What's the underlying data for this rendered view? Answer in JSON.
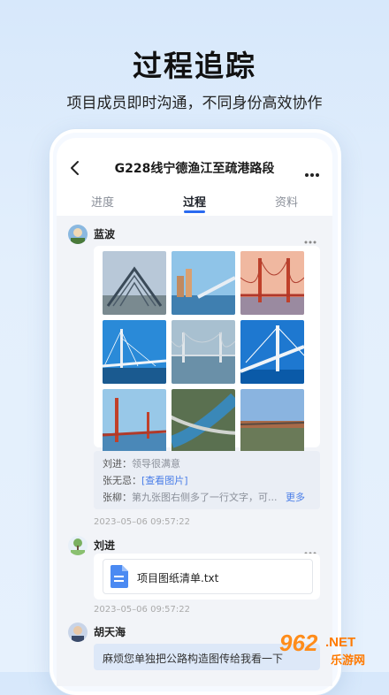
{
  "promo": {
    "headline": "过程追踪",
    "subline": "项目成员即时沟通，不同身份高效协作"
  },
  "app": {
    "title": "G228线宁德渔江至疏港路段",
    "tabs": [
      {
        "label": "进度",
        "active": false
      },
      {
        "label": "过程",
        "active": true
      },
      {
        "label": "资料",
        "active": false
      }
    ],
    "accent_color": "#2a6af0"
  },
  "posts": [
    {
      "author": "蓝波",
      "photo_count": 9,
      "comments": [
        {
          "name": "刘进：",
          "text": "领导很满意"
        },
        {
          "name": "张无忌：",
          "link": "[查看图片]"
        },
        {
          "name": "张柳：",
          "text": "第九张图右侧多了一行文字，可...",
          "more": "更多"
        }
      ],
      "timestamp": "2023–05–06 09:57:22"
    },
    {
      "author": "刘进",
      "file": {
        "icon": "document-icon",
        "name": "项目图纸清单.txt"
      },
      "timestamp": "2023–05–06 09:57:22"
    },
    {
      "author": "胡天海",
      "message": "麻烦您单独把公路构造图传给我看一下"
    }
  ],
  "watermark": {
    "number": "962",
    "domain": ".NET",
    "site": "乐游网"
  }
}
